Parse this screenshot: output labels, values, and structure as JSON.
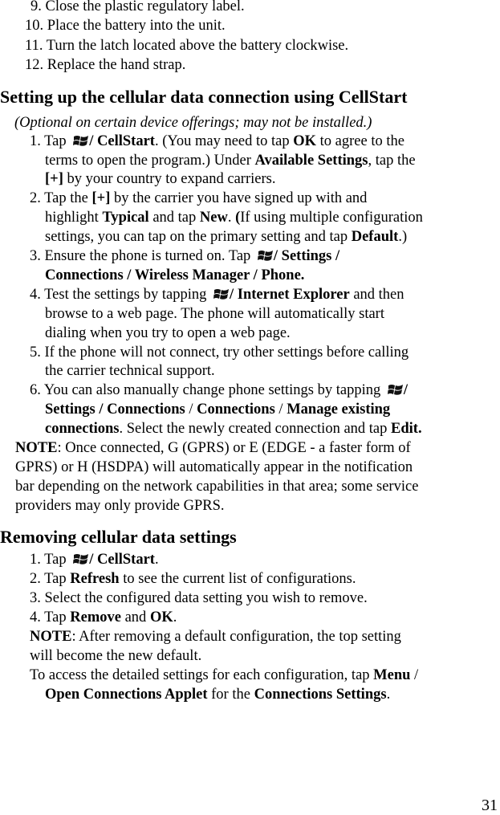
{
  "top_steps": [
    "9. Close the plastic regulatory label.",
    "10. Place the battery into the unit.",
    "11. Turn the latch located above the battery clockwise.",
    "12. Replace the hand strap."
  ],
  "section1": {
    "heading": "Setting up the cellular data connection using CellStart",
    "note": "(Optional on certain device offerings; may not be installed.)",
    "s1": {
      "a": "1. Tap",
      "b": "/ CellStart",
      "c": ". (You may need to tap ",
      "d": "OK",
      "e": " to agree to the"
    },
    "s1l2": {
      "a": "terms to open the program.) Under ",
      "b": "Available Settings",
      "c": ", tap the"
    },
    "s1l3": {
      "a": "[+]",
      "b": " by your country to expand carriers."
    },
    "s2": {
      "a": "2. Tap the ",
      "b": "[+]",
      "c": " by the carrier you have signed up with and"
    },
    "s2l2": {
      "a": "highlight ",
      "b": "Typical",
      "c": " and tap ",
      "d": "New",
      "e": ". ",
      "f": "(",
      "g": "If using multiple configuration"
    },
    "s2l3": {
      "a": "settings, you can tap on the primary setting and tap ",
      "b": "Default",
      "c": ".)"
    },
    "s3": {
      "a": "3. Ensure the phone is turned on. Tap",
      "b": "/ Settings /"
    },
    "s3l2": {
      "a": "Connections / Wireless Manager / Phone."
    },
    "s4": {
      "a": "4. Test the settings by tapping",
      "b": "/ Internet Explorer",
      "c": " and then"
    },
    "s4l2": "browse to a web page. The phone will automatically start",
    "s4l3": "dialing when you try to open a web page.",
    "s5": "5. If the phone will not connect, try other settings before calling",
    "s5l2": "the carrier technical support.",
    "s6": {
      "a": "6. You can also manually change phone settings by tapping",
      "b": "/"
    },
    "s6l2": {
      "a": "Settings / Connections",
      "b": " / ",
      "c": "Connections",
      "d": " / ",
      "e": "Manage existing"
    },
    "s6l3": {
      "a": "connections",
      "b": ". Select the newly created connection and tap ",
      "c": "Edit."
    },
    "note_label": "NOTE",
    "note_l1": ": Once connected, G (GPRS) or E (EDGE - a faster form of",
    "note_l2": "GPRS) or H (HSDPA) will automatically appear in the notification",
    "note_l3": "bar depending on the network capabilities in that area; some service",
    "note_l4": "providers may only provide GPRS."
  },
  "section2": {
    "heading": "Removing cellular data settings",
    "s1": {
      "a": "1. Tap",
      "b": "/ CellStart",
      "c": "."
    },
    "s2": {
      "a": "2. Tap ",
      "b": "Refresh",
      "c": " to see the current list of configurations."
    },
    "s3": "3. Select the configured data setting you wish to remove.",
    "s4": {
      "a": "4. Tap ",
      "b": "Remove",
      "c": " and ",
      "d": "OK",
      "e": "."
    },
    "note_label": "NOTE",
    "note_l1": ": After removing a default configuration, the top setting",
    "note_l2": "will become the new default.",
    "access_l1": {
      "a": "To access the detailed settings for each configuration, tap ",
      "b": "Menu",
      "c": " /"
    },
    "access_l2": {
      "a": "Open Connections Applet",
      "b": " for the ",
      "c": "Connections Settings",
      "d": "."
    }
  },
  "page_number": "31",
  "icons": {
    "start": "windows-start-icon"
  }
}
